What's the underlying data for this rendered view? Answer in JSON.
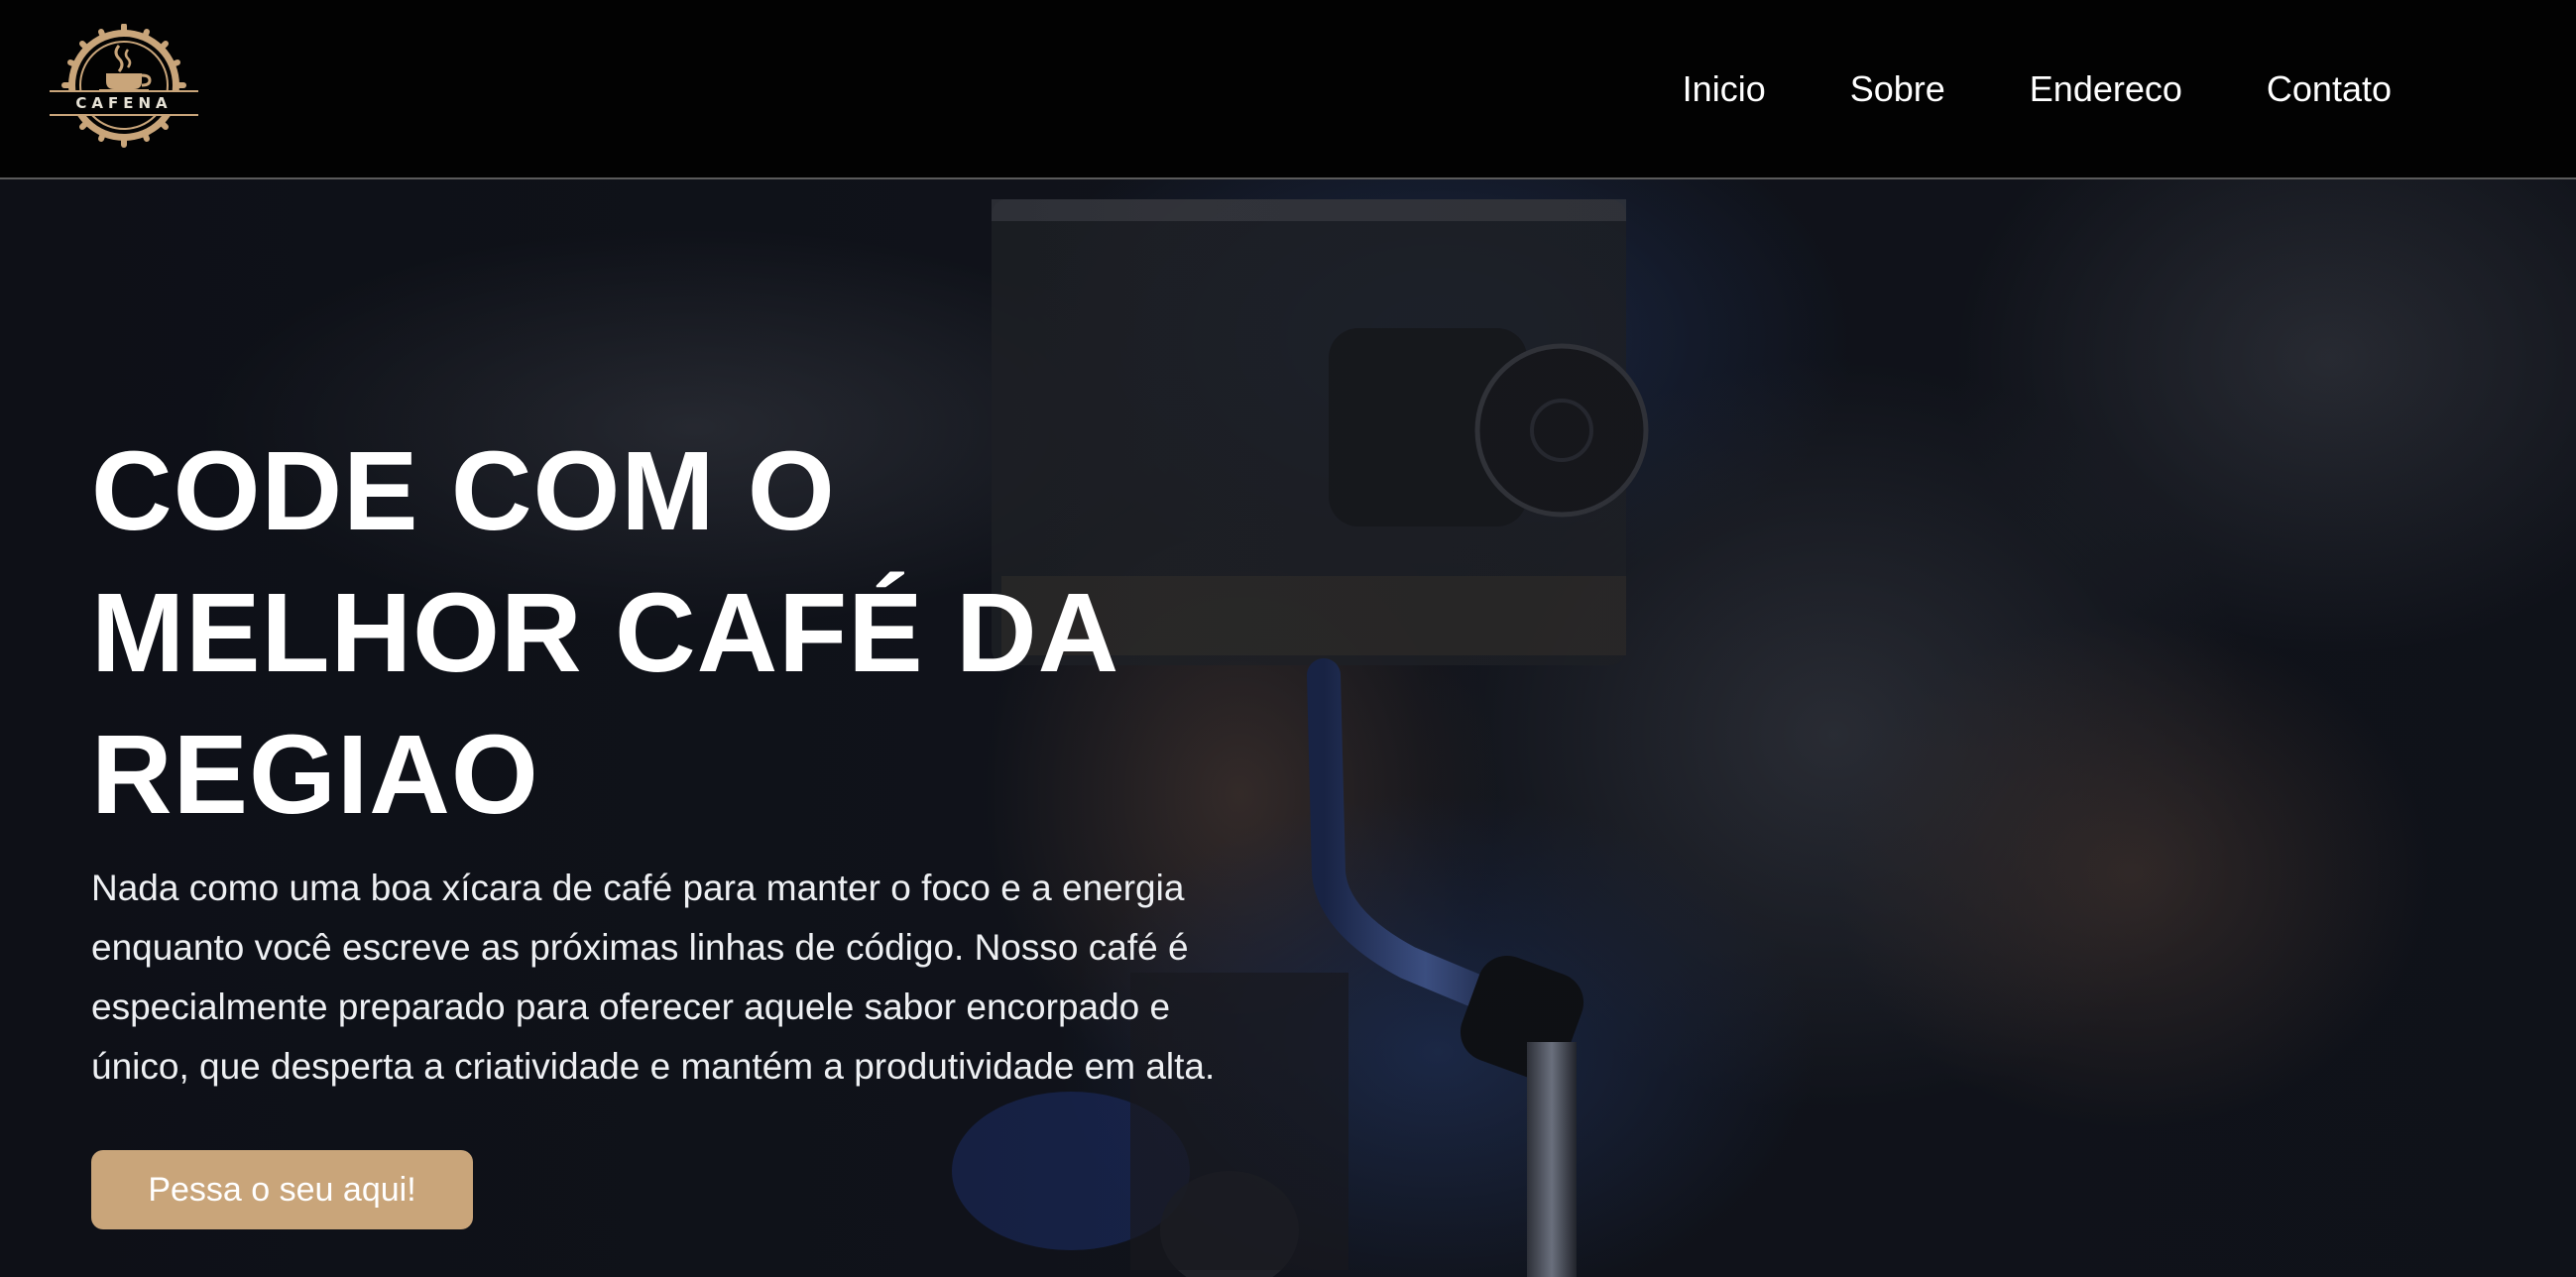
{
  "header": {
    "logo_text": "CAFENA",
    "nav": [
      "Inicio",
      "Sobre",
      "Endereco",
      "Contato"
    ]
  },
  "hero": {
    "title_lines": [
      "CODE COM O",
      "MELHOR CAFÉ DA",
      "REGIAO"
    ],
    "text_lines": [
      "Nada como uma boa xícara de café para manter o foco e a energia",
      "enquanto você escreve as próximas linhas de código. Nosso café é",
      "especialmente preparado para oferecer aquele sabor encorpado e",
      "único, que desperta a criatividade e mantém a produtividade em alta."
    ],
    "cta_label": "Pessa o seu aqui!"
  },
  "colors": {
    "header_bg": "#020202",
    "accent": "#c9a57a",
    "text": "#ffffff"
  },
  "icons": {
    "logo": "coffee-cup-gear-badge"
  }
}
